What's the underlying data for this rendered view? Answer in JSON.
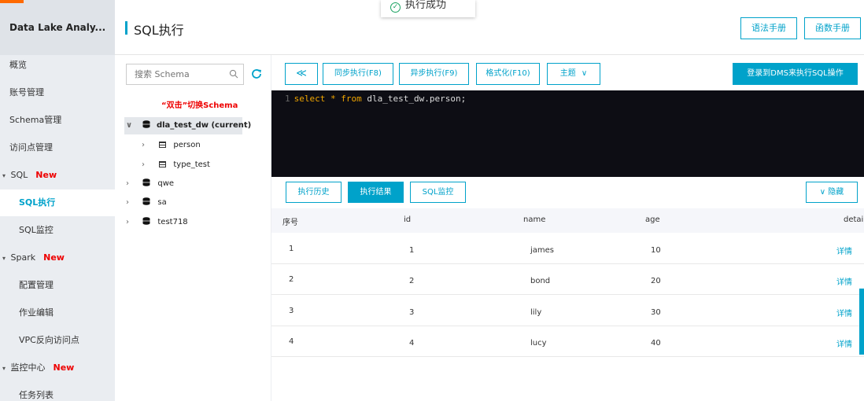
{
  "nav": {
    "brand": "Data Lake Analy...",
    "items": [
      {
        "label": "概览"
      },
      {
        "label": "账号管理"
      },
      {
        "label": "Schema管理"
      },
      {
        "label": "访问点管理"
      },
      {
        "label": "SQL",
        "tag": "New"
      },
      {
        "label": "SQL执行"
      },
      {
        "label": "SQL监控"
      },
      {
        "label": "Spark",
        "tag": "New"
      },
      {
        "label": "配置管理"
      },
      {
        "label": "作业编辑"
      },
      {
        "label": "VPC反向访问点"
      },
      {
        "label": "监控中心",
        "tag": "New"
      },
      {
        "label": "任务列表"
      }
    ]
  },
  "header": {
    "title": "SQL执行",
    "syntax_button": "语法手册",
    "function_button": "函数手册"
  },
  "toast": {
    "message": "执行成功"
  },
  "schema": {
    "search_placeholder": "搜索 Schema",
    "hint": "“双击”切换Schema",
    "databases": [
      {
        "name": "dla_test_dw (current)",
        "tables": [
          "person",
          "type_test"
        ]
      },
      {
        "name": "qwe"
      },
      {
        "name": "sa"
      },
      {
        "name": "test718"
      }
    ]
  },
  "toolbar": {
    "collapse": "≪",
    "sync_exec": "同步执行(F8)",
    "async_exec": "异步执行(F9)",
    "format": "格式化(F10)",
    "theme": "主题",
    "dms_login": "登录到DMS来执行SQL操作"
  },
  "editor": {
    "line_number": "1",
    "kw_select": "select",
    "star": "*",
    "kw_from": "from",
    "table": "dla_test_dw.person;"
  },
  "results": {
    "tabs": [
      "执行历史",
      "执行结果",
      "SQL监控"
    ],
    "active_tab": "执行结果",
    "hide": "隐藏",
    "columns": [
      "序号",
      "id",
      "name",
      "age",
      "detai"
    ],
    "rows": [
      {
        "seq": "1",
        "id": "1",
        "name": "james",
        "age": "10",
        "detail": "详情"
      },
      {
        "seq": "2",
        "id": "2",
        "name": "bond",
        "age": "20",
        "detail": "详情"
      },
      {
        "seq": "3",
        "id": "3",
        "name": "lily",
        "age": "30",
        "detail": "详情"
      },
      {
        "seq": "4",
        "id": "4",
        "name": "lucy",
        "age": "40",
        "detail": "详情"
      }
    ]
  },
  "colors": {
    "accent": "#00a2ca",
    "new_tag": "#ee0000",
    "editor_bg": "#0d0d14",
    "keyword": "#f0a500"
  },
  "icons": [
    "search-icon",
    "refresh-icon",
    "chevron-right-icon",
    "chevron-down-icon",
    "database-icon",
    "table-icon",
    "check-circle-icon",
    "double-chevron-left-icon"
  ]
}
